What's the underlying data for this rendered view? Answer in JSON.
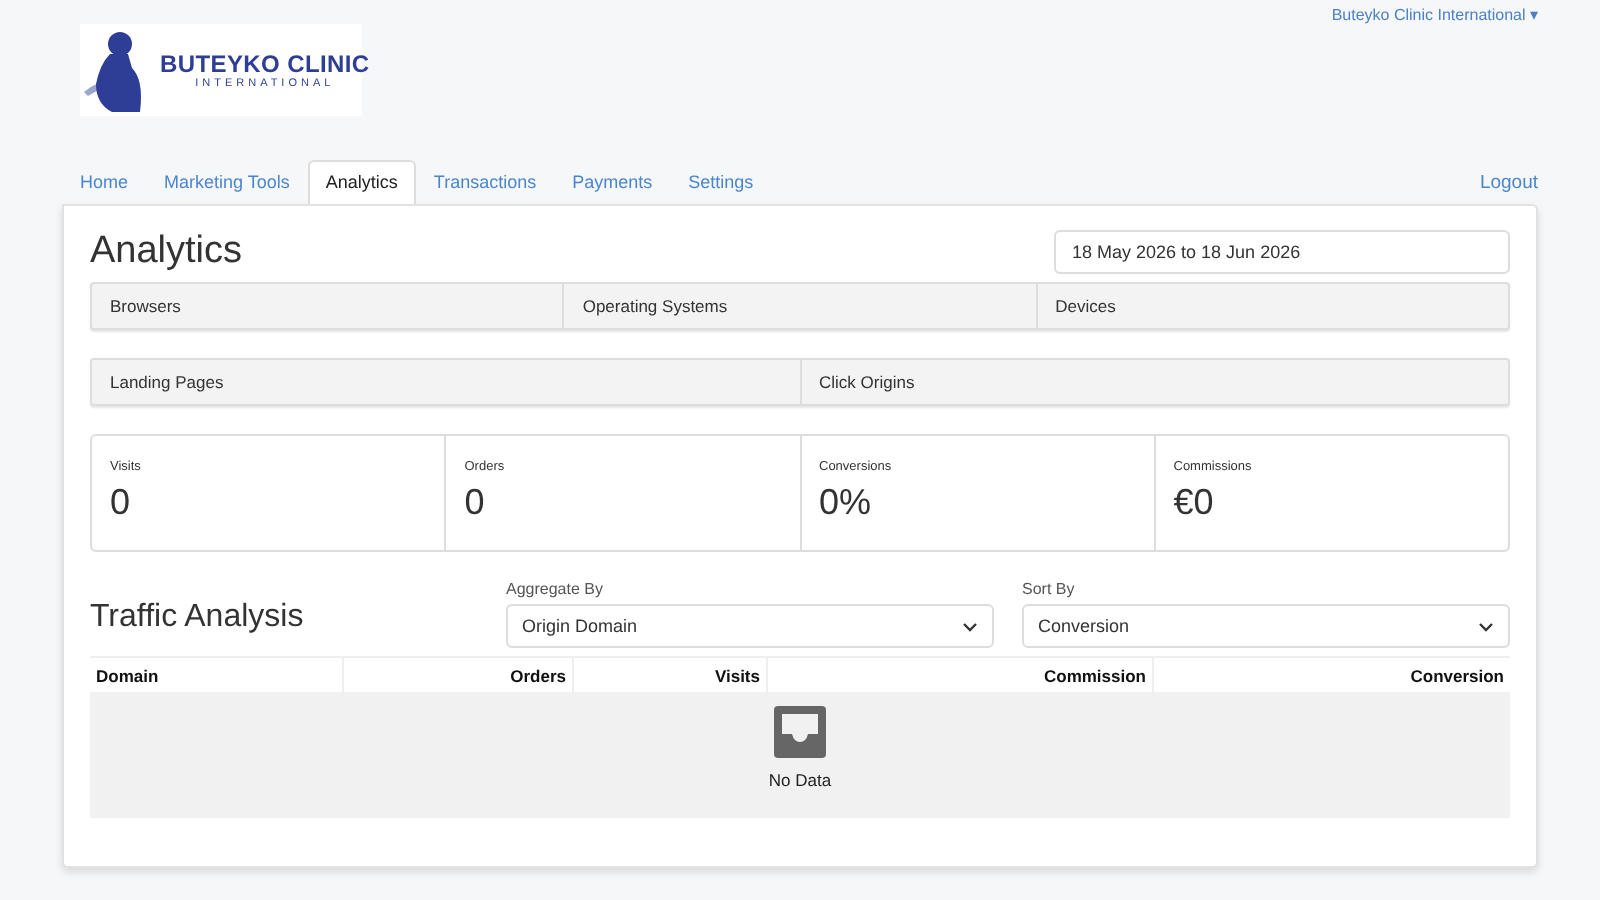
{
  "logo": {
    "name": "BUTEYKO CLINIC",
    "subtitle": "INTERNATIONAL"
  },
  "account_menu": {
    "label": "Buteyko Clinic International",
    "caret": "▾"
  },
  "tabs": [
    {
      "label": "Home",
      "selected": false
    },
    {
      "label": "Marketing Tools",
      "selected": false
    },
    {
      "label": "Analytics",
      "selected": true
    },
    {
      "label": "Transactions",
      "selected": false
    },
    {
      "label": "Payments",
      "selected": false
    },
    {
      "label": "Settings",
      "selected": false
    }
  ],
  "logout": "Logout",
  "page_title": "Analytics",
  "date_range": "18 May 2026 to 18 Jun 2026",
  "breakdown_tabs": [
    [
      "Browsers",
      "Operating Systems",
      "Devices"
    ],
    [
      "Landing Pages",
      "Click Origins"
    ]
  ],
  "stats": [
    {
      "label": "Visits",
      "value": "0"
    },
    {
      "label": "Orders",
      "value": "0"
    },
    {
      "label": "Conversions",
      "value": "0%"
    },
    {
      "label": "Commissions",
      "value": "€0"
    }
  ],
  "traffic": {
    "title": "Traffic Analysis",
    "aggregate_by": {
      "label": "Aggregate By",
      "value": "Origin Domain"
    },
    "sort_by": {
      "label": "Sort By",
      "value": "Conversion"
    },
    "columns": [
      "Domain",
      "Orders",
      "Visits",
      "Commission",
      "Conversion"
    ],
    "empty_text": "No Data"
  }
}
